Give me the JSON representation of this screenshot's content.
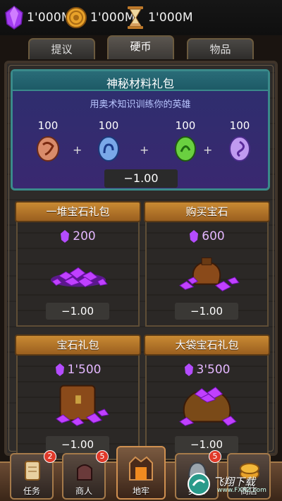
{
  "currency": {
    "gems": "1'000M",
    "coins": "1'000M",
    "hourglass": "1'000M"
  },
  "tabs": [
    {
      "label": "提议",
      "active": false
    },
    {
      "label": "硬币",
      "active": true
    },
    {
      "label": "物品",
      "active": false
    }
  ],
  "featured": {
    "title": "神秘材料礼包",
    "subtitle": "用奥术知识训练你的英雄",
    "items": [
      {
        "count": "100",
        "color": "#e09070"
      },
      {
        "count": "100",
        "color": "#7aa8e8"
      },
      {
        "count": "100",
        "color": "#6ad040"
      },
      {
        "count": "100",
        "color": "#b58be8"
      }
    ],
    "plus": "+",
    "price": "−1.00"
  },
  "bundles": [
    {
      "title": "一堆宝石礼包",
      "gems": "200",
      "price": "−1.00",
      "art": "gem-pile"
    },
    {
      "title": "购买宝石",
      "gems": "600",
      "price": "−1.00",
      "art": "gem-bag"
    },
    {
      "title": "宝石礼包",
      "gems": "1'500",
      "price": "−1.00",
      "art": "gem-chest"
    },
    {
      "title": "大袋宝石礼包",
      "gems": "3'500",
      "price": "−1.00",
      "art": "gem-sack"
    }
  ],
  "nav": {
    "quests": {
      "label": "任务",
      "badge": "2"
    },
    "merchant": {
      "label": "商人",
      "badge": "5"
    },
    "dungeon": {
      "label": "地牢"
    },
    "heroes": {
      "label": "英雄",
      "badge": "5"
    },
    "shop": {
      "label": "商店"
    }
  },
  "watermark": {
    "text": "飞翔下载",
    "url": "www.FXXZ.com"
  },
  "colors": {
    "gem": "#b44cff",
    "accent": "#c98a33",
    "frame": "#3a8a8a"
  }
}
